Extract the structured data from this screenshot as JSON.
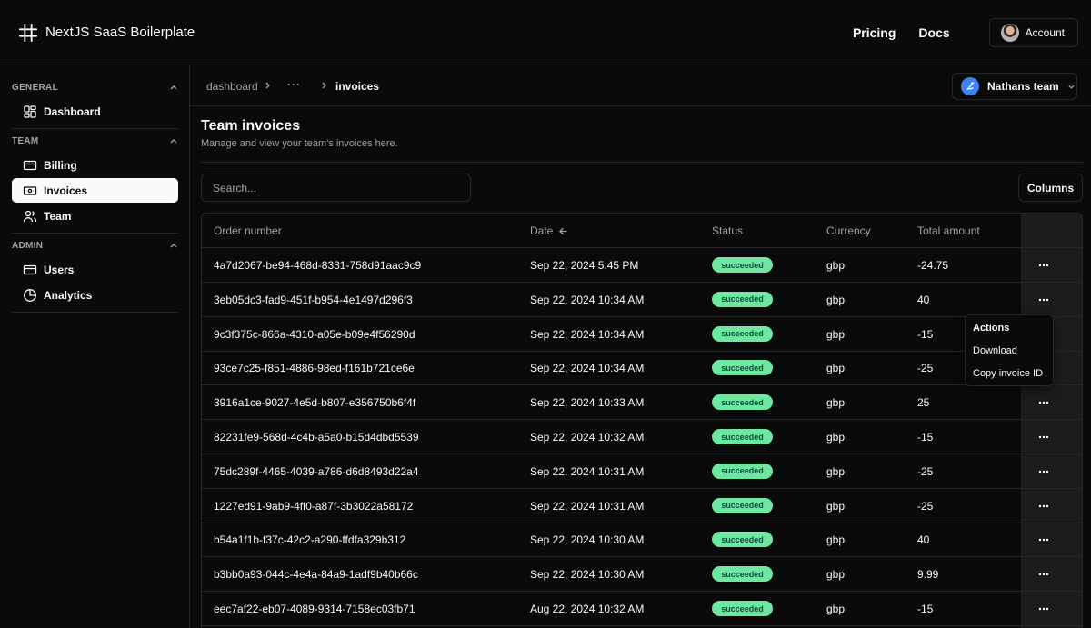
{
  "app": {
    "brand": "NextJS SaaS Boilerplate",
    "nav": {
      "pricing": "Pricing",
      "docs": "Docs",
      "account": "Account"
    }
  },
  "sidebar": {
    "sections": [
      {
        "title": "GENERAL",
        "items": [
          {
            "label": "Dashboard",
            "icon": "layout-grid-icon"
          }
        ]
      },
      {
        "title": "TEAM",
        "items": [
          {
            "label": "Billing",
            "icon": "credit-card-icon"
          },
          {
            "label": "Invoices",
            "icon": "banknote-icon",
            "active": true
          },
          {
            "label": "Team",
            "icon": "users-icon"
          }
        ]
      },
      {
        "title": "ADMIN",
        "items": [
          {
            "label": "Users",
            "icon": "credit-card-icon"
          },
          {
            "label": "Analytics",
            "icon": "pie-chart-icon"
          }
        ]
      }
    ]
  },
  "breadcrumb": {
    "root": "dashboard",
    "ellipsis": "···",
    "current": "invoices"
  },
  "team_switcher": {
    "name": "Nathans team"
  },
  "page": {
    "title": "Team invoices",
    "subtitle": "Manage and view your team's invoices here."
  },
  "search": {
    "placeholder": "Search...",
    "value": ""
  },
  "columns_button": "Columns",
  "table": {
    "headers": {
      "order": "Order number",
      "date": "Date",
      "status": "Status",
      "currency": "Currency",
      "amount": "Total amount"
    },
    "sort": {
      "column": "date",
      "direction": "desc"
    },
    "rows": [
      {
        "order": "4a7d2067-be94-468d-8331-758d91aac9c9",
        "date": "Sep 22, 2024 5:45 PM",
        "status": "succeeded",
        "currency": "gbp",
        "amount": "-24.75"
      },
      {
        "order": "3eb05dc3-fad9-451f-b954-4e1497d296f3",
        "date": "Sep 22, 2024 10:34 AM",
        "status": "succeeded",
        "currency": "gbp",
        "amount": "40"
      },
      {
        "order": "9c3f375c-866a-4310-a05e-b09e4f56290d",
        "date": "Sep 22, 2024 10:34 AM",
        "status": "succeeded",
        "currency": "gbp",
        "amount": "-15"
      },
      {
        "order": "93ce7c25-f851-4886-98ed-f161b721ce6e",
        "date": "Sep 22, 2024 10:34 AM",
        "status": "succeeded",
        "currency": "gbp",
        "amount": "-25"
      },
      {
        "order": "3916a1ce-9027-4e5d-b807-e356750b6f4f",
        "date": "Sep 22, 2024 10:33 AM",
        "status": "succeeded",
        "currency": "gbp",
        "amount": "25"
      },
      {
        "order": "82231fe9-568d-4c4b-a5a0-b15d4dbd5539",
        "date": "Sep 22, 2024 10:32 AM",
        "status": "succeeded",
        "currency": "gbp",
        "amount": "-15"
      },
      {
        "order": "75dc289f-4465-4039-a786-d6d8493d22a4",
        "date": "Sep 22, 2024 10:31 AM",
        "status": "succeeded",
        "currency": "gbp",
        "amount": "-25"
      },
      {
        "order": "1227ed91-9ab9-4ff0-a87f-3b3022a58172",
        "date": "Sep 22, 2024 10:31 AM",
        "status": "succeeded",
        "currency": "gbp",
        "amount": "-25"
      },
      {
        "order": "b54a1f1b-f37c-42c2-a290-ffdfa329b312",
        "date": "Sep 22, 2024 10:30 AM",
        "status": "succeeded",
        "currency": "gbp",
        "amount": "40"
      },
      {
        "order": "b3bb0a93-044c-4e4a-84a9-1adf9b40b66c",
        "date": "Sep 22, 2024 10:30 AM",
        "status": "succeeded",
        "currency": "gbp",
        "amount": "9.99"
      },
      {
        "order": "eec7af22-eb07-4089-9314-7158ec03fb71",
        "date": "Aug 22, 2024 10:32 AM",
        "status": "succeeded",
        "currency": "gbp",
        "amount": "-15"
      }
    ]
  },
  "row_actions_menu": {
    "title": "Actions",
    "items": [
      "Download",
      "Copy invoice ID"
    ]
  },
  "colors": {
    "background": "#0a0a0a",
    "border": "#27272a",
    "text": "#fafafa",
    "muted": "#a1a1aa",
    "success_badge": "#6ee7a0",
    "team_logo": "#3b82f6"
  }
}
